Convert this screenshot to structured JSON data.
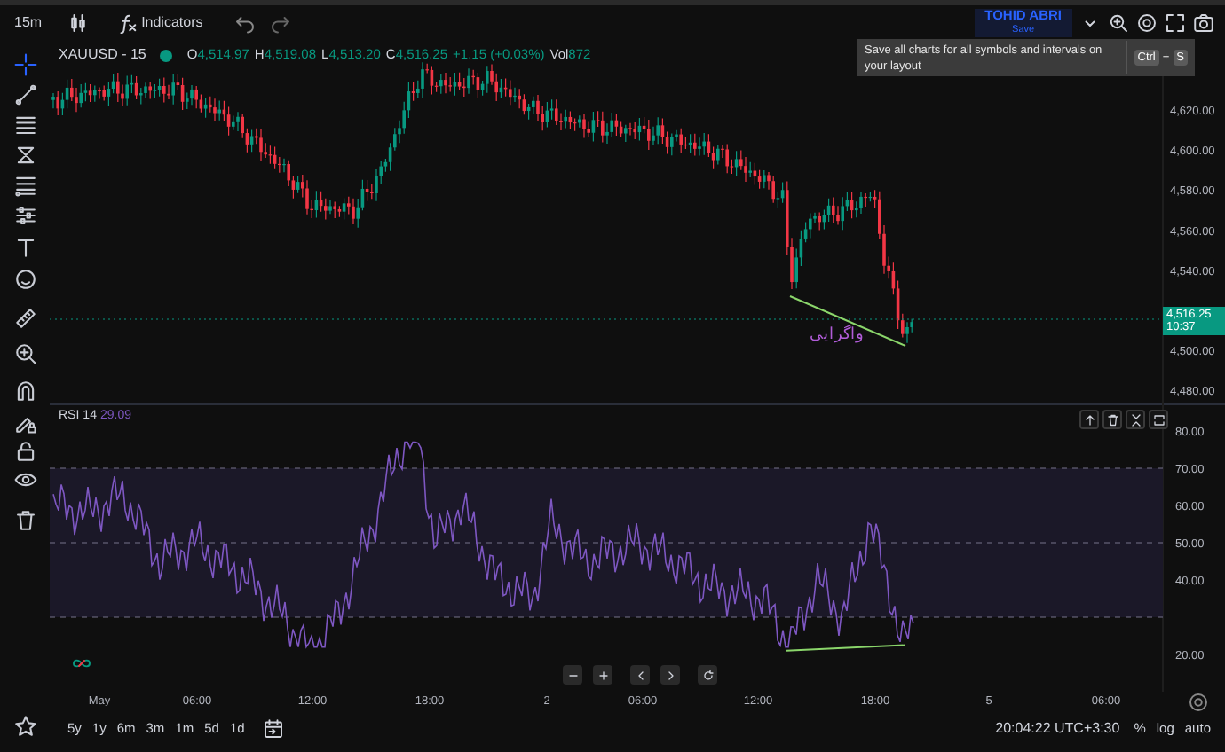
{
  "toolbar": {
    "interval": "15m",
    "indicators": "Indicators",
    "user": "TOHID ABRI",
    "save": "Save"
  },
  "tooltip": {
    "text": "Save all charts for all symbols and intervals on your layout",
    "shortcut": [
      {
        "kind": "key",
        "text": "Ctrl"
      },
      {
        "kind": "joiner",
        "text": "+"
      },
      {
        "kind": "key",
        "text": "S"
      }
    ]
  },
  "tools": [
    {
      "selected": true
    },
    {
      "selected": false
    },
    {
      "selected": false
    },
    {
      "selected": false
    },
    {
      "selected": false
    },
    {
      "selected": false
    },
    {
      "selected": false
    },
    {
      "selected": false
    },
    {
      "selected": false
    },
    {
      "selected": false
    },
    {
      "selected": false
    },
    {
      "selected": false
    },
    {
      "selected": false
    },
    {
      "selected": false
    },
    {
      "selected": false
    }
  ],
  "legend": {
    "symbol": "XAUUSD - 15",
    "market_open": true,
    "rising": true,
    "fields": [
      {
        "label": "O",
        "value": "4,514.97"
      },
      {
        "label": "H",
        "value": "4,519.08"
      },
      {
        "label": "L",
        "value": "4,513.20"
      },
      {
        "label": "C",
        "value": "4,516.25"
      }
    ],
    "change": "+1.15 (+0.03%)",
    "volume_label": "Vol",
    "volume": "872"
  },
  "price_axis": [
    "4,620.00",
    "4,600.00",
    "4,580.00",
    "4,560.00",
    "4,540.00",
    "4,500.00",
    "4,480.00"
  ],
  "current_price": {
    "price": "4,516.25",
    "countdown": "10:37"
  },
  "annotation": "واگرایی",
  "rsi": {
    "name": "RSI",
    "length": "14",
    "value": "29.09"
  },
  "rsi_axis": [
    "80.00",
    "70.00",
    "60.00",
    "50.00",
    "40.00",
    "20.00"
  ],
  "time_axis": [
    "May",
    "06:00",
    "12:00",
    "18:00",
    "2",
    "06:00",
    "12:00",
    "18:00",
    "5",
    "06:00"
  ],
  "ranges": [
    "5y",
    "1y",
    "6m",
    "3m",
    "1m",
    "5d",
    "1d"
  ],
  "status": {
    "clock": "20:04:22 UTC+3:30",
    "percent": "%",
    "log": "log",
    "auto": "auto"
  }
}
